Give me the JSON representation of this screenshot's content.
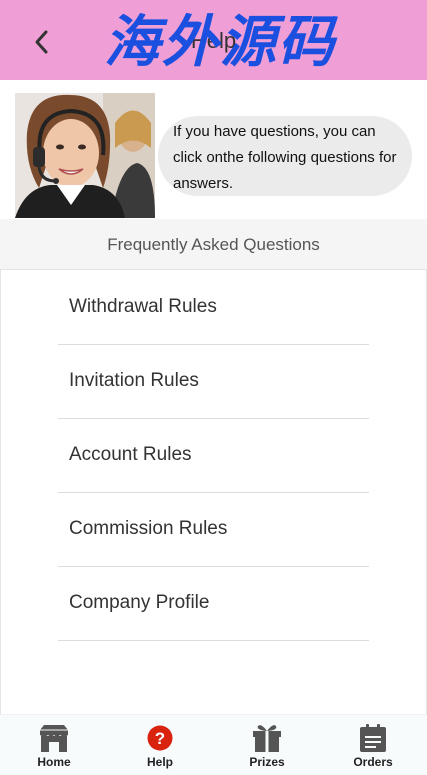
{
  "header": {
    "title": "Help",
    "back_icon": "chevron-left-icon",
    "background": "#ef9ed6",
    "watermark": "海外源码"
  },
  "intro": {
    "avatar": "customer-support-agent-photo",
    "message": "If you have questions, you can click onthe following questions for answers."
  },
  "faq": {
    "heading": "Frequently Asked Questions",
    "items": [
      {
        "label": "Withdrawal Rules"
      },
      {
        "label": "Invitation Rules"
      },
      {
        "label": "Account Rules"
      },
      {
        "label": "Commission Rules"
      },
      {
        "label": "Company Profile"
      }
    ]
  },
  "tabbar": {
    "tabs": [
      {
        "label": "Home",
        "icon": "store-icon"
      },
      {
        "label": "Help",
        "icon": "question-circle-icon",
        "active_color": "#d9230f"
      },
      {
        "label": "Prizes",
        "icon": "gift-icon"
      },
      {
        "label": "Orders",
        "icon": "clipboard-icon"
      }
    ]
  }
}
